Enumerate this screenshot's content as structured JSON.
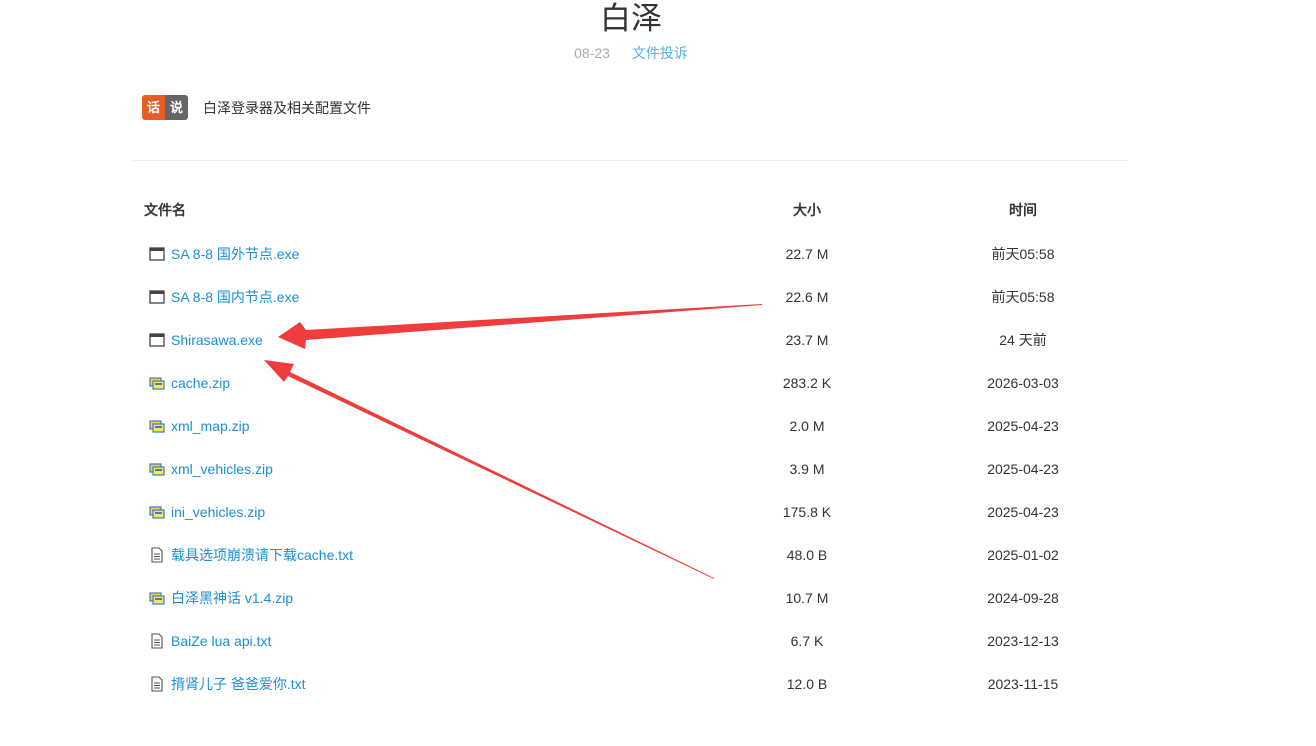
{
  "header": {
    "title": "白泽",
    "date": "08-23",
    "category": "文件投诉"
  },
  "say": {
    "badge_left": "话",
    "badge_right": "说",
    "text": "白泽登录器及相关配置文件"
  },
  "table": {
    "columns": {
      "name": "文件名",
      "size": "大小",
      "time": "时间"
    },
    "rows": [
      {
        "name": "SA 8-8 国外节点.exe",
        "size": "22.7 M",
        "time": "前天05:58",
        "icon": "exe-window-icon"
      },
      {
        "name": "SA 8-8 国内节点.exe",
        "size": "22.6 M",
        "time": "前天05:58",
        "icon": "exe-window-icon"
      },
      {
        "name": "Shirasawa.exe",
        "size": "23.7 M",
        "time": "24 天前",
        "icon": "exe-window-icon"
      },
      {
        "name": "cache.zip",
        "size": "283.2 K",
        "time": "2026-03-03",
        "icon": "zip-archive-icon"
      },
      {
        "name": "xml_map.zip",
        "size": "2.0 M",
        "time": "2025-04-23",
        "icon": "zip-archive-icon"
      },
      {
        "name": "xml_vehicles.zip",
        "size": "3.9 M",
        "time": "2025-04-23",
        "icon": "zip-archive-icon"
      },
      {
        "name": "ini_vehicles.zip",
        "size": "175.8 K",
        "time": "2025-04-23",
        "icon": "zip-archive-icon"
      },
      {
        "name": "载具选项崩溃请下载cache.txt",
        "size": "48.0 B",
        "time": "2025-01-02",
        "icon": "text-file-icon"
      },
      {
        "name": "白泽黑神话 v1.4.zip",
        "size": "10.7 M",
        "time": "2024-09-28",
        "icon": "zip-archive-icon"
      },
      {
        "name": "BaiZe lua api.txt",
        "size": "6.7 K",
        "time": "2023-12-13",
        "icon": "text-file-icon"
      },
      {
        "name": "揹肾儿子 爸爸爱你.txt",
        "size": "12.0 B",
        "time": "2023-11-15",
        "icon": "text-file-icon"
      }
    ]
  },
  "colors": {
    "link": "#1a8fd6",
    "category": "#5aaee6",
    "badge_orange": "#e45e25",
    "badge_gray": "#666666",
    "arrow_red": "#f03c3c"
  }
}
